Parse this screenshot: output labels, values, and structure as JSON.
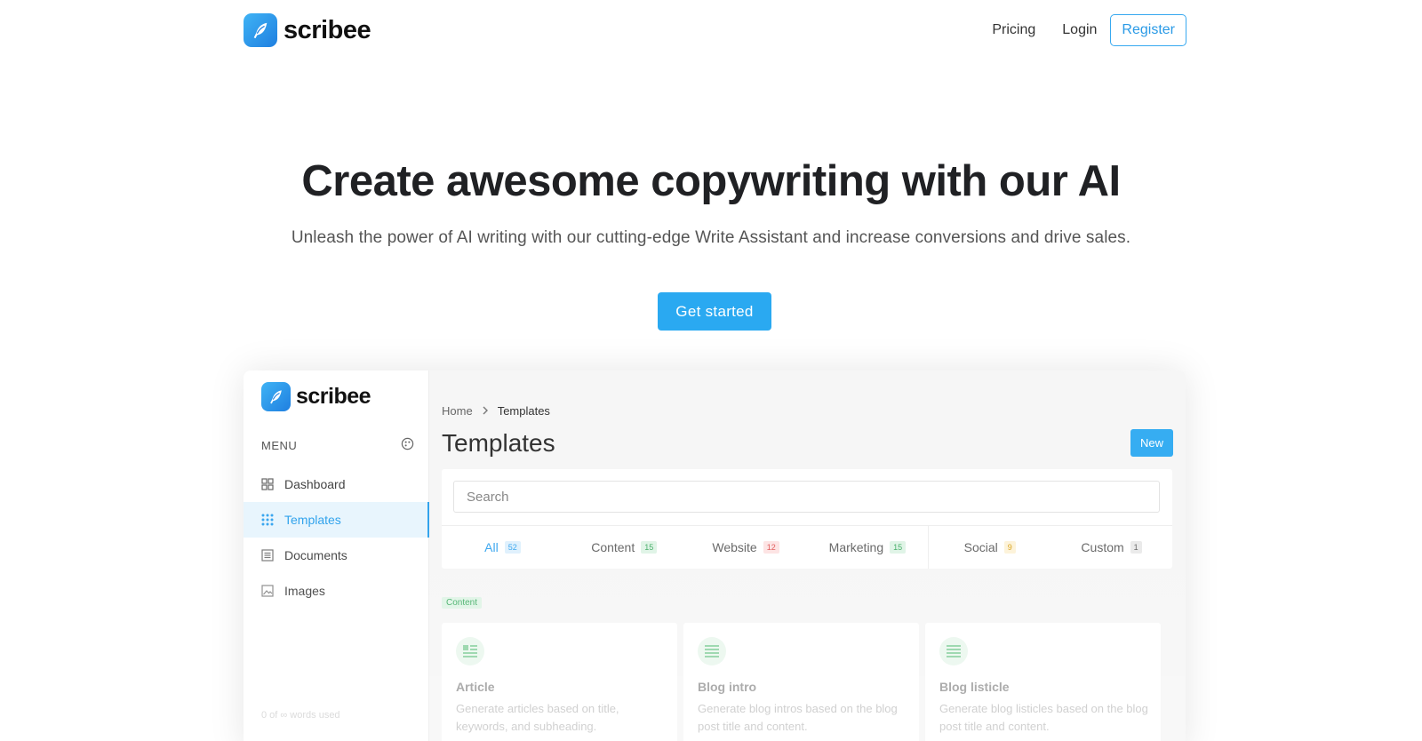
{
  "brand": {
    "name": "scribee"
  },
  "nav": {
    "pricing": "Pricing",
    "login": "Login",
    "register": "Register"
  },
  "hero": {
    "title": "Create awesome copywriting with our AI",
    "subtitle": "Unleash the power of AI writing with our cutting-edge Write Assistant and increase conversions and drive sales.",
    "cta": "Get started"
  },
  "preview": {
    "brand": "scribee",
    "menu_label": "MENU",
    "menu": [
      {
        "label": "Dashboard",
        "icon": "grid-icon"
      },
      {
        "label": "Templates",
        "icon": "dots-grid-icon",
        "active": true
      },
      {
        "label": "Documents",
        "icon": "document-icon"
      },
      {
        "label": "Images",
        "icon": "image-icon"
      }
    ],
    "words_used": "0 of ∞ words used",
    "breadcrumb": {
      "home": "Home",
      "current": "Templates"
    },
    "page_title": "Templates",
    "new_button": "New",
    "search_placeholder": "Search",
    "tabs": [
      {
        "label": "All",
        "count": "52",
        "active": true
      },
      {
        "label": "Content",
        "count": "15"
      },
      {
        "label": "Website",
        "count": "12"
      },
      {
        "label": "Marketing",
        "count": "15"
      },
      {
        "label": "Social",
        "count": "9"
      },
      {
        "label": "Custom",
        "count": "1"
      }
    ],
    "section_label": "Content",
    "templates": [
      {
        "name": "Article",
        "desc": "Generate articles based on title, keywords, and subheading."
      },
      {
        "name": "Blog intro",
        "desc": "Generate blog intros based on the blog post title and content."
      },
      {
        "name": "Blog listicle",
        "desc": "Generate blog listicles based on the blog post title and content."
      }
    ]
  },
  "colors": {
    "accent": "#2aa9f1",
    "text": "#202124"
  }
}
